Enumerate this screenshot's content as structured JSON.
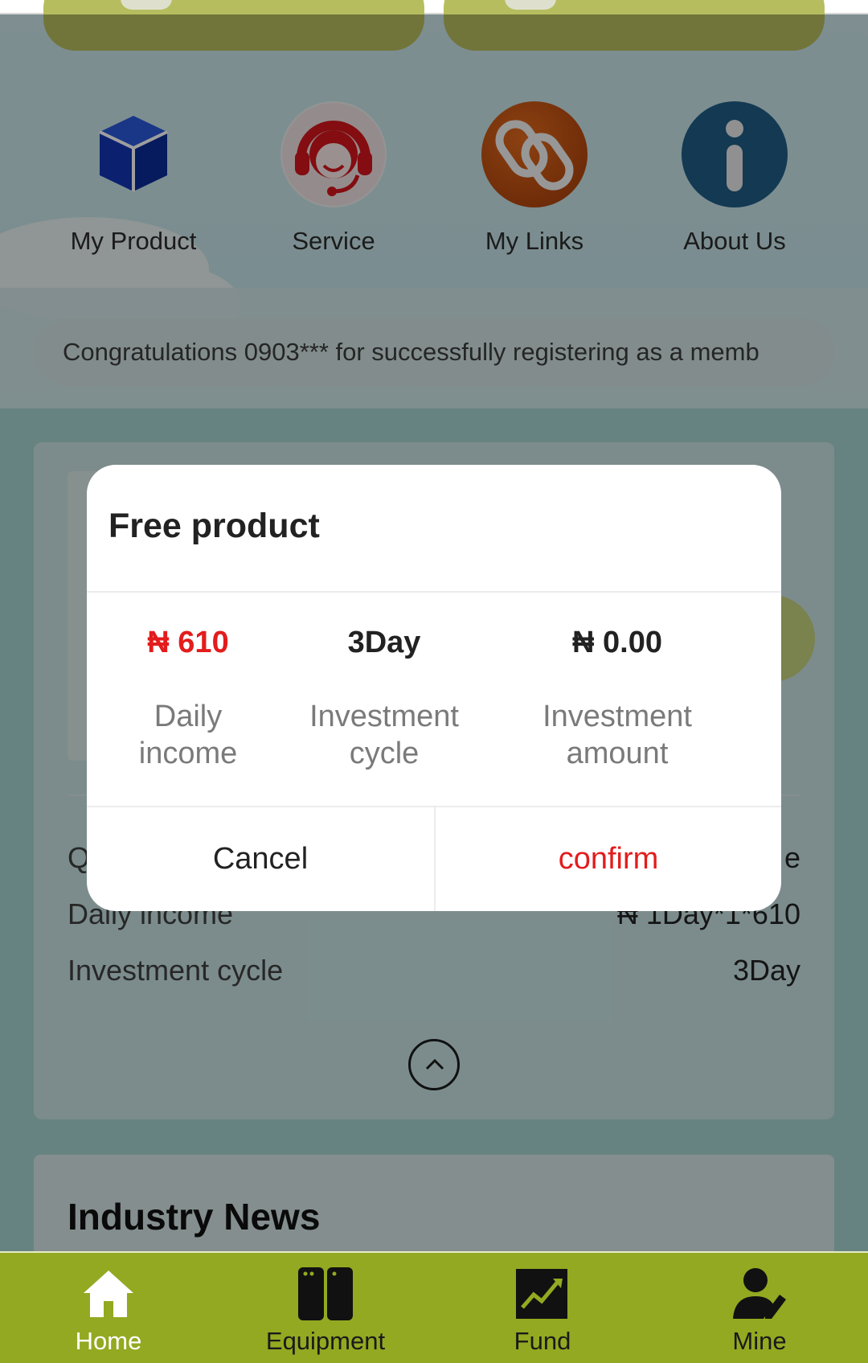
{
  "quick_links": [
    {
      "label": "My Product",
      "icon": "cube-icon",
      "color": "#1236b5"
    },
    {
      "label": "Service",
      "icon": "headset-agent-icon",
      "color": "#d3161c"
    },
    {
      "label": "My Links",
      "icon": "chain-link-icon",
      "color": "#c8460b"
    },
    {
      "label": "About Us",
      "icon": "info-icon",
      "color": "#1f5c86"
    }
  ],
  "announcement": "Congratulations 0903*** for successfully registering as a memb",
  "product_card": {
    "rows": [
      {
        "label": "Q",
        "value": "e"
      },
      {
        "label": "Daily income",
        "value": "₦ 1Day*1*610"
      },
      {
        "label": "Investment cycle",
        "value": "3Day"
      }
    ]
  },
  "news": {
    "title": "Industry News"
  },
  "modal": {
    "title": "Free product",
    "stats": [
      {
        "value": "₦ 610",
        "label": "Daily income",
        "highlight": true
      },
      {
        "value": "3Day",
        "label": "Investment cycle",
        "highlight": false
      },
      {
        "value": "₦ 0.00",
        "label": "Investment amount",
        "highlight": false
      }
    ],
    "cancel_label": "Cancel",
    "confirm_label": "confirm"
  },
  "bottom_nav": [
    {
      "label": "Home",
      "icon": "home-icon",
      "active": true
    },
    {
      "label": "Equipment",
      "icon": "equipment-icon",
      "active": false
    },
    {
      "label": "Fund",
      "icon": "chart-trend-icon",
      "active": false
    },
    {
      "label": "Mine",
      "icon": "user-edit-icon",
      "active": false
    }
  ],
  "colors": {
    "accent_red": "#e31c1c",
    "nav_green": "#93a921",
    "top_button_olive": "#b6bd5e"
  }
}
